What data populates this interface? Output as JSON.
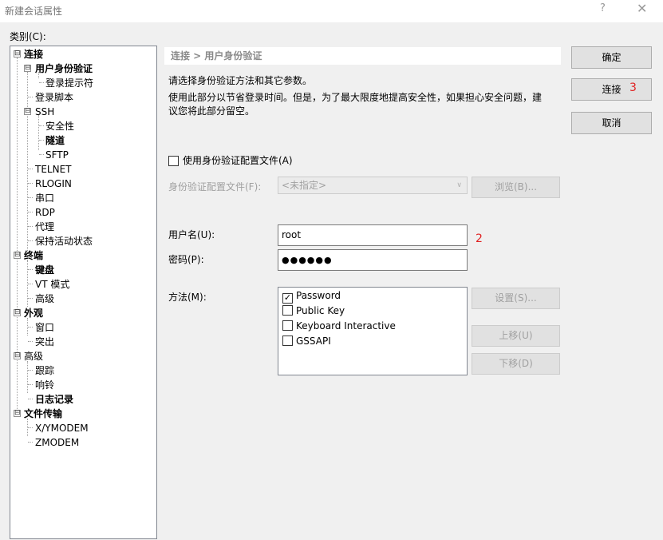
{
  "window": {
    "title": "新建会话属性",
    "help": "?",
    "close": "✕"
  },
  "category_label": "类别(C):",
  "tree": {
    "connection": "连接",
    "user_auth": "用户身份验证",
    "login_prompt": "登录提示符",
    "login_script": "登录脚本",
    "ssh": "SSH",
    "security": "安全性",
    "tunnel": "隧道",
    "sftp": "SFTP",
    "telnet": "TELNET",
    "rlogin": "RLOGIN",
    "serial": "串口",
    "rdp": "RDP",
    "proxy": "代理",
    "keepalive": "保持活动状态",
    "terminal": "终端",
    "keyboard": "键盘",
    "vt_mode": "VT 模式",
    "advanced": "高级",
    "appearance": "外观",
    "window": "窗口",
    "highlight": "突出",
    "advanced2": "高级",
    "trace": "跟踪",
    "bell": "响铃",
    "logging": "日志记录",
    "file_transfer": "文件传输",
    "xymodem": "X/YMODEM",
    "zmodem": "ZMODEM",
    "expand_sign": "⊟"
  },
  "panel": {
    "header": "连接 > 用户身份验证",
    "desc1": "请选择身份验证方法和其它参数。",
    "desc2a": "使用此部分以节省登录时间。但是，为了最大限度地提高安全性，如果担心安全问题，建",
    "desc2b": "议您将此部分留空。",
    "use_profile_label": "使用身份验证配置文件(A)",
    "profile_label": "身份验证配置文件(F):",
    "profile_value": "<未指定>",
    "browse_button": "浏览(B)...",
    "username_label": "用户名(U):",
    "username_value": "root",
    "password_label": "密码(P):",
    "password_value": "●●●●●●",
    "method_label": "方法(M):",
    "methods": [
      {
        "label": "Password",
        "checked": true
      },
      {
        "label": "Public Key",
        "checked": false
      },
      {
        "label": "Keyboard Interactive",
        "checked": false
      },
      {
        "label": "GSSAPI",
        "checked": false
      }
    ],
    "settings_button": "设置(S)...",
    "move_up_button": "上移(U)",
    "move_down_button": "下移(D)"
  },
  "buttons": {
    "ok": "确定",
    "connect": "连接",
    "cancel": "取消"
  },
  "annotations": {
    "a2": "2",
    "a3": "3"
  },
  "checkmark": "✓"
}
